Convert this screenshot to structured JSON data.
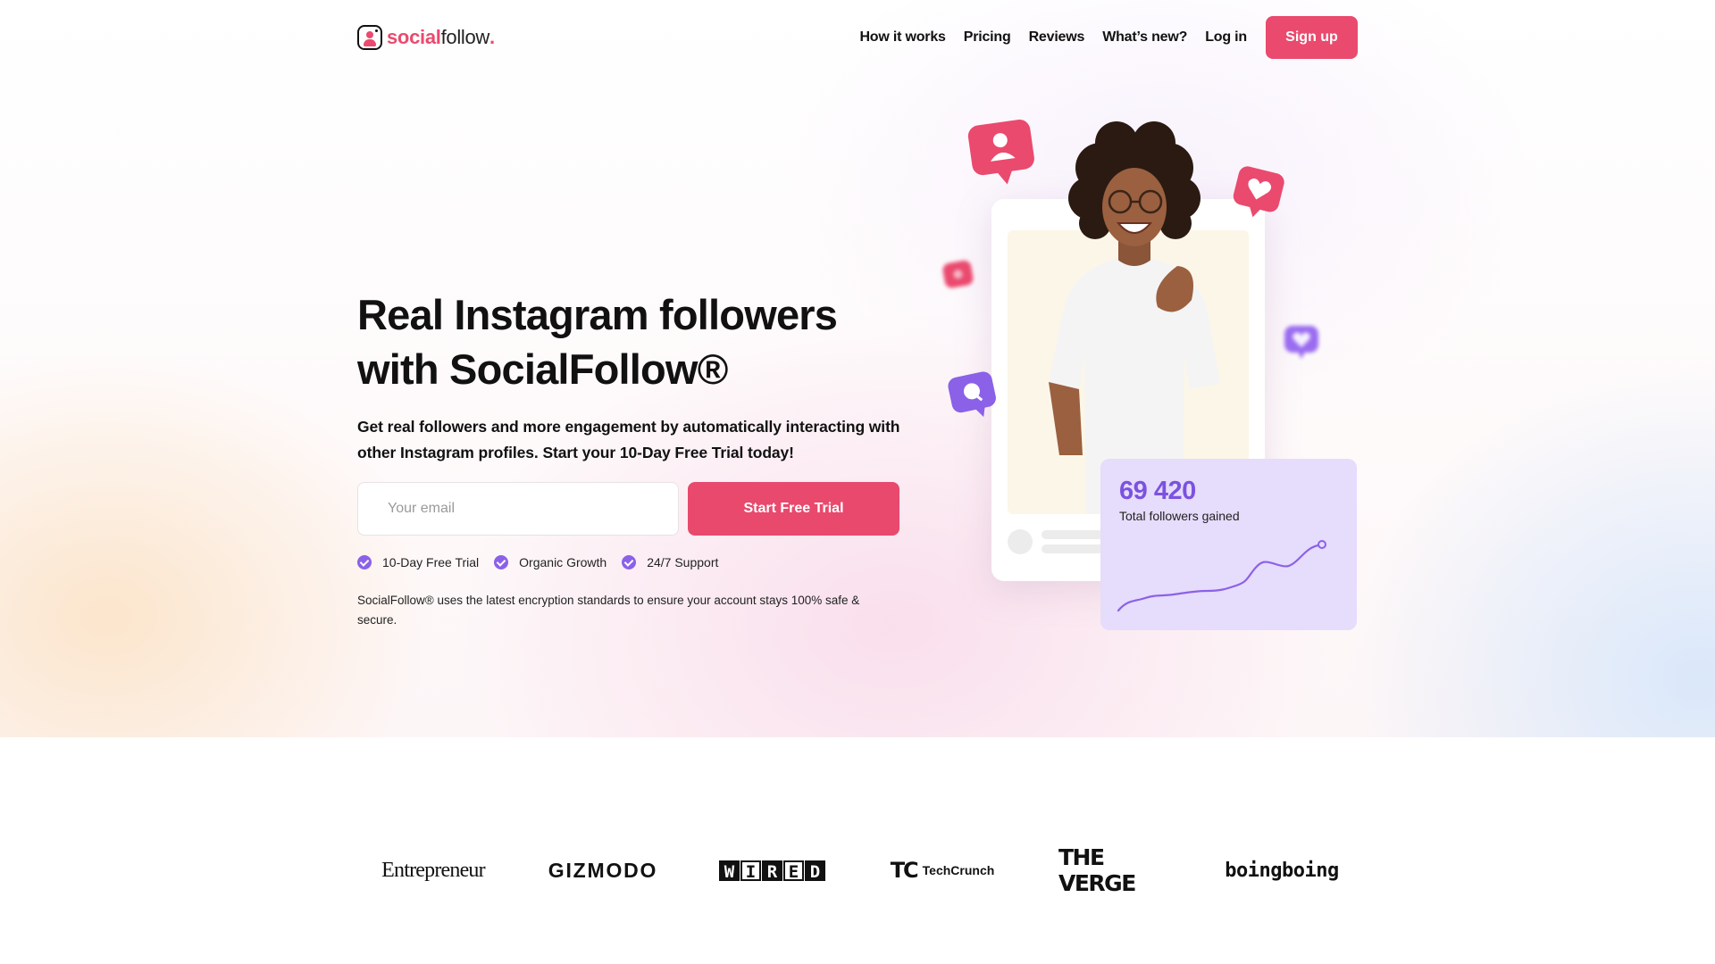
{
  "brand": {
    "name_part1": "social",
    "name_part2": "follow",
    "name_part3": ".",
    "accent": "#ea4a6e",
    "purple": "#8b61e8"
  },
  "nav": {
    "items": [
      "How it works",
      "Pricing",
      "Reviews",
      "What’s new?",
      "Log in"
    ],
    "signup_label": "Sign up"
  },
  "hero": {
    "headline_line1": "Real Instagram followers",
    "headline_line2": "with SocialFollow®",
    "subheadline": "Get real followers and more engagement by automatically interacting with other Instagram profiles. Start your 10-Day Free Trial today!",
    "email_placeholder": "Your email",
    "cta_label": "Start Free Trial",
    "features": [
      "10-Day Free Trial",
      "Organic Growth",
      "24/7 Support"
    ],
    "security_note": "SocialFollow® uses the latest encryption standards to ensure your account stays 100% safe & secure."
  },
  "stats_card": {
    "number": "69 420",
    "label": "Total followers gained"
  },
  "press": {
    "logos": [
      "Entrepreneur",
      "GIZMODO",
      "WIRED",
      "TechCrunch",
      "THE VERGE",
      "boingboing"
    ],
    "wired_letters": [
      "W",
      "I",
      "R",
      "E",
      "D"
    ],
    "tc_mark": "TC"
  }
}
